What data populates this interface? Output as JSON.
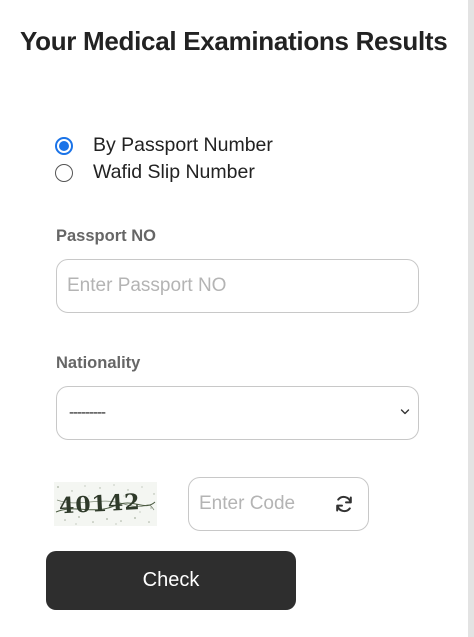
{
  "page": {
    "title": "Your Medical Examinations Results"
  },
  "search_type": {
    "options": [
      {
        "label": "By Passport Number",
        "selected": true
      },
      {
        "label": "Wafid Slip Number",
        "selected": false
      }
    ]
  },
  "passport": {
    "label": "Passport NO",
    "placeholder": "Enter Passport NO",
    "value": ""
  },
  "nationality": {
    "label": "Nationality",
    "selected": "---------"
  },
  "captcha": {
    "image_text": "40142",
    "code_placeholder": "Enter Code",
    "refresh_icon": "refresh-icon"
  },
  "actions": {
    "check_label": "Check"
  },
  "colors": {
    "accent": "#1a73e8",
    "button": "#2e2e2e",
    "border": "#c8c8c8"
  }
}
